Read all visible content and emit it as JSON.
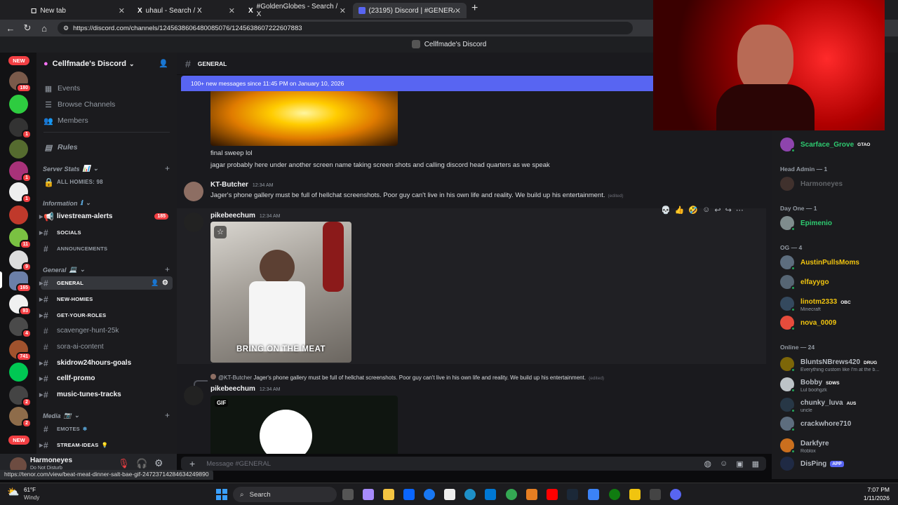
{
  "browser": {
    "tabs": [
      {
        "title": "New tab"
      },
      {
        "title": "uhaul - Search / X"
      },
      {
        "title": "#GoldenGlobes - Search / X"
      },
      {
        "title": "(23195) Discord | #GENERAL | Cellfm..."
      }
    ],
    "new_tab": "+",
    "url": "https://discord.com/channels/1245638606480085076/1245638607222607883",
    "status_url": "https://tenor.com/view/beat-meat-dinner-salt-bae-gif-24723714284634249890"
  },
  "window_title": "Cellfmade's Discord",
  "rail": {
    "new_label": "NEW",
    "badges": [
      "180",
      "1",
      "1",
      "1",
      "11",
      "9",
      "165",
      "93",
      "4",
      "741",
      "2",
      "2"
    ]
  },
  "server": {
    "name": "Cellfmade's Discord",
    "top_items": [
      "Events",
      "Browse Channels",
      "Members"
    ],
    "rules": "Rules",
    "categories": {
      "server_stats": "Server Stats",
      "information": "Information",
      "general": "General",
      "media": "Media"
    },
    "stats_channel": "ALL HOMIES: 98",
    "info_channels": [
      {
        "name": "livestream-alerts",
        "count": "185"
      },
      {
        "name": "SOCIALS"
      },
      {
        "name": "ANNOUNCEMENTS"
      }
    ],
    "general_channels": [
      "GENERAL",
      "NEW-HOMIES",
      "GET-YOUR-ROLES",
      "scavenger-hunt-25k",
      "sora-ai-content",
      "skidrow24hours-goals",
      "cellf-promo",
      "music-tunes-tracks"
    ],
    "media_channels": [
      "EMOTES",
      "STREAM-IDEAS"
    ]
  },
  "user": {
    "name": "Harmoneyes",
    "status": "Do Not Disturb"
  },
  "chat": {
    "channel": "GENERAL",
    "new_messages_bar": "100+ new messages since 11:45 PM on January 10, 2026",
    "messages": [
      {
        "text": "final sweep lol"
      },
      {
        "text": "jagar probably here under another screen name taking screen shots and calling discord head quarters as we speak"
      },
      {
        "author": "KT-Butcher",
        "time": "12:34 AM",
        "text": "Jager's phone gallery must be full of hellchat screenshots. Poor guy can't live in his own life and reality. We build up his entertainment.",
        "edited": "(edited)"
      },
      {
        "author": "pikebeechum",
        "time": "12:34 AM",
        "gif_caption": "BRING ON THE MEAT"
      },
      {
        "reply_to": "@KT-Butcher",
        "reply_text": "Jager's phone gallery must be full of hellchat screenshots. Poor guy can't live in his own life and reality. We build up his entertainment.",
        "edited": "(edited)",
        "author": "pikebeechum",
        "time": "12:34 AM",
        "gif_label": "GIF"
      }
    ],
    "composer_placeholder": "Message #GENERAL"
  },
  "members": {
    "sections": [
      {
        "header": "Head Admin — 1",
        "y": 0
      },
      {
        "header": "Day One — 1"
      },
      {
        "header": "OG — 4"
      },
      {
        "header": "Online — 24"
      }
    ],
    "list": [
      {
        "name": "Scarface_Grove",
        "tag": "GTAO",
        "color": "#2ecc71"
      },
      {
        "name": "Harmoneyes",
        "color": "#3b3d44"
      },
      {
        "name": "Epimenio",
        "color": "#2ecc71"
      },
      {
        "name": "AustinPullsMoms",
        "color": "#f1c40f"
      },
      {
        "name": "elfayygo",
        "color": "#f1c40f"
      },
      {
        "name": "linotm2333",
        "tag": "OBC",
        "sub": "Minecraft",
        "color": "#f1c40f"
      },
      {
        "name": "nova_0009",
        "color": "#f1c40f"
      },
      {
        "name": "BluntsNBrews420",
        "tag": "DRUG",
        "sub": "Everything custom like I'm at the b...",
        "color": "#b5bac1"
      },
      {
        "name": "Bobby",
        "tag": "SDWS",
        "sub": "Lul boohgzk",
        "color": "#b5bac1"
      },
      {
        "name": "chunky_luva",
        "tag": "AUS",
        "sub": "uncle",
        "color": "#b5bac1"
      },
      {
        "name": "crackwhore710",
        "color": "#b5bac1"
      },
      {
        "name": "Darkfyre",
        "sub": "Roblox",
        "color": "#b5bac1"
      },
      {
        "name": "DisPing",
        "tag": "APP",
        "color": "#b5bac1"
      }
    ]
  },
  "taskbar": {
    "weather_temp": "61°F",
    "weather_desc": "Windy",
    "search": "Search",
    "time": "7:07 PM",
    "date": "1/11/2026"
  },
  "colors": {
    "accent": "#5865f2",
    "danger": "#f23f43",
    "online": "#23a55a"
  }
}
